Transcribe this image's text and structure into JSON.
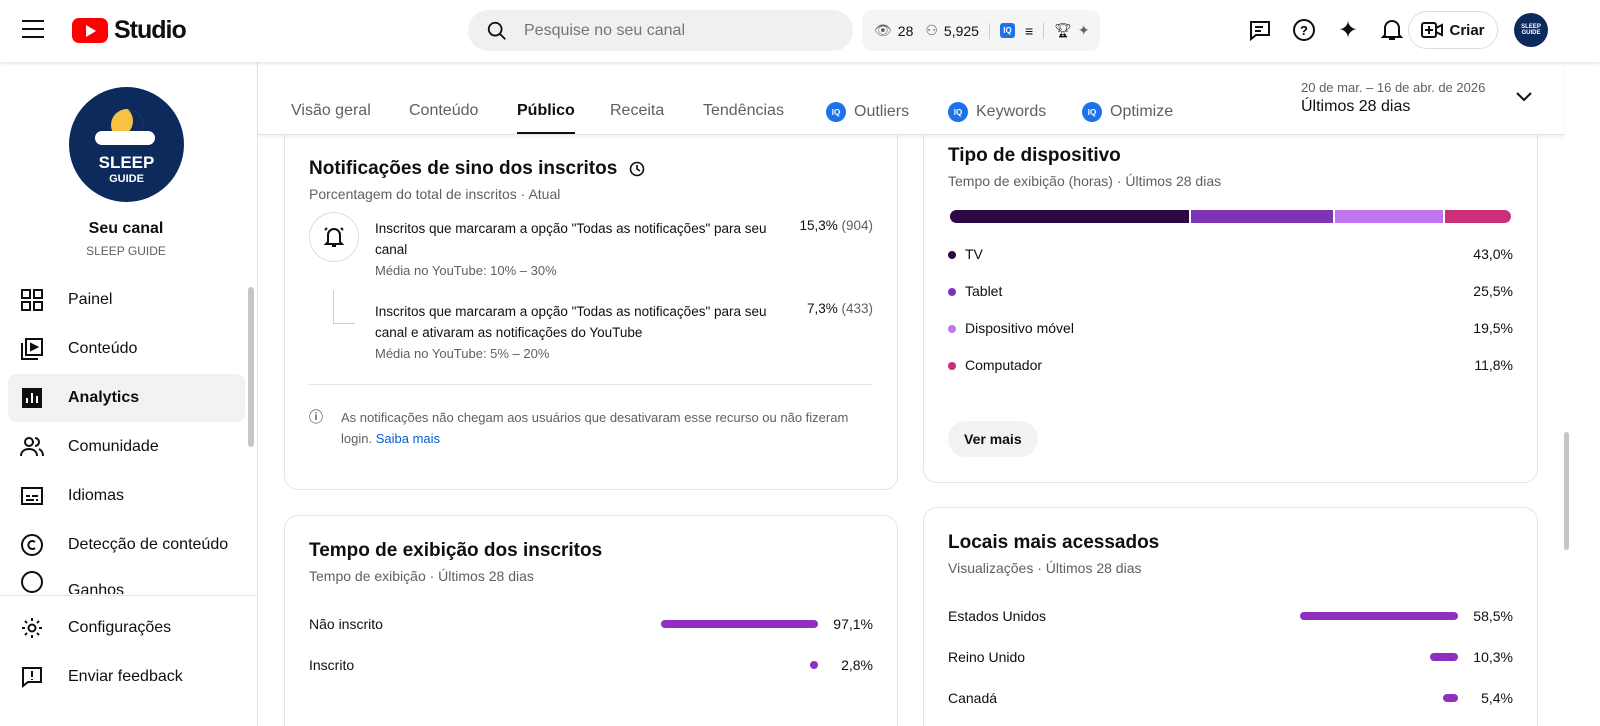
{
  "header": {
    "brand": "Studio",
    "search_placeholder": "Pesquise no seu canal",
    "views": "28",
    "subscribers": "5,925",
    "create_label": "Criar",
    "avatar_text": "SLEEP GUIDE"
  },
  "sidebar": {
    "channel_label": "Seu canal",
    "channel_name": "SLEEP GUIDE",
    "avatar_line1": "SLEEP",
    "avatar_line2": "GUIDE",
    "items": [
      {
        "label": "Painel"
      },
      {
        "label": "Conteúdo"
      },
      {
        "label": "Analytics"
      },
      {
        "label": "Comunidade"
      },
      {
        "label": "Idiomas"
      },
      {
        "label": "Detecção de conteúdo"
      },
      {
        "label": "Ganhos"
      }
    ],
    "bottom": [
      {
        "label": "Configurações"
      },
      {
        "label": "Enviar feedback"
      }
    ]
  },
  "tabs": [
    {
      "label": "Visão geral"
    },
    {
      "label": "Conteúdo"
    },
    {
      "label": "Público"
    },
    {
      "label": "Receita"
    },
    {
      "label": "Tendências"
    },
    {
      "label": "Outliers"
    },
    {
      "label": "Keywords"
    },
    {
      "label": "Optimize"
    }
  ],
  "date": {
    "range": "20 de mar. – 16 de abr. de 2026",
    "label": "Últimos 28 dias"
  },
  "bell": {
    "title": "Notificações de sino dos inscritos",
    "subtitle": "Porcentagem do total de inscritos · Atual",
    "rows": [
      {
        "label": "Inscritos que marcaram a opção \"Todas as notificações\" para seu canal",
        "avg": "Média no YouTube: 10% – 30%",
        "pct": "15,3%",
        "count": "(904)"
      },
      {
        "label": "Inscritos que marcaram a opção \"Todas as notificações\" para seu canal e ativaram as notificações do YouTube",
        "avg": "Média no YouTube: 5% – 20%",
        "pct": "7,3%",
        "count": "(433)"
      }
    ],
    "note": "As notificações não chegam aos usuários que desativaram esse recurso ou não fizeram login.",
    "link": "Saiba mais"
  },
  "device": {
    "title": "Tipo de dispositivo",
    "subtitle": "Tempo de exibição (horas) · Últimos 28 dias",
    "button": "Ver mais",
    "items": [
      {
        "label": "TV",
        "pct": "43,0%",
        "value": 43.0,
        "color": "#2e0845"
      },
      {
        "label": "Tablet",
        "pct": "25,5%",
        "value": 25.5,
        "color": "#7f34b5"
      },
      {
        "label": "Dispositivo móvel",
        "pct": "19,5%",
        "value": 19.5,
        "color": "#c074f0"
      },
      {
        "label": "Computador",
        "pct": "11,8%",
        "value": 11.8,
        "color": "#cc2f7a"
      }
    ]
  },
  "watch": {
    "title": "Tempo de exibição dos inscritos",
    "subtitle": "Tempo de exibição · Últimos 28 dias",
    "items": [
      {
        "label": "Não inscrito",
        "pct": "97,1%",
        "value": 97.1
      },
      {
        "label": "Inscrito",
        "pct": "2,8%",
        "value": 2.8
      }
    ]
  },
  "places": {
    "title": "Locais mais acessados",
    "subtitle": "Visualizações · Últimos 28 dias",
    "items": [
      {
        "label": "Estados Unidos",
        "pct": "58,5%",
        "value": 58.5
      },
      {
        "label": "Reino Unido",
        "pct": "10,3%",
        "value": 10.3
      },
      {
        "label": "Canadá",
        "pct": "5,4%",
        "value": 5.4
      }
    ]
  },
  "colors": {
    "bar": "#8e2fc0",
    "link": "#065fd4"
  }
}
